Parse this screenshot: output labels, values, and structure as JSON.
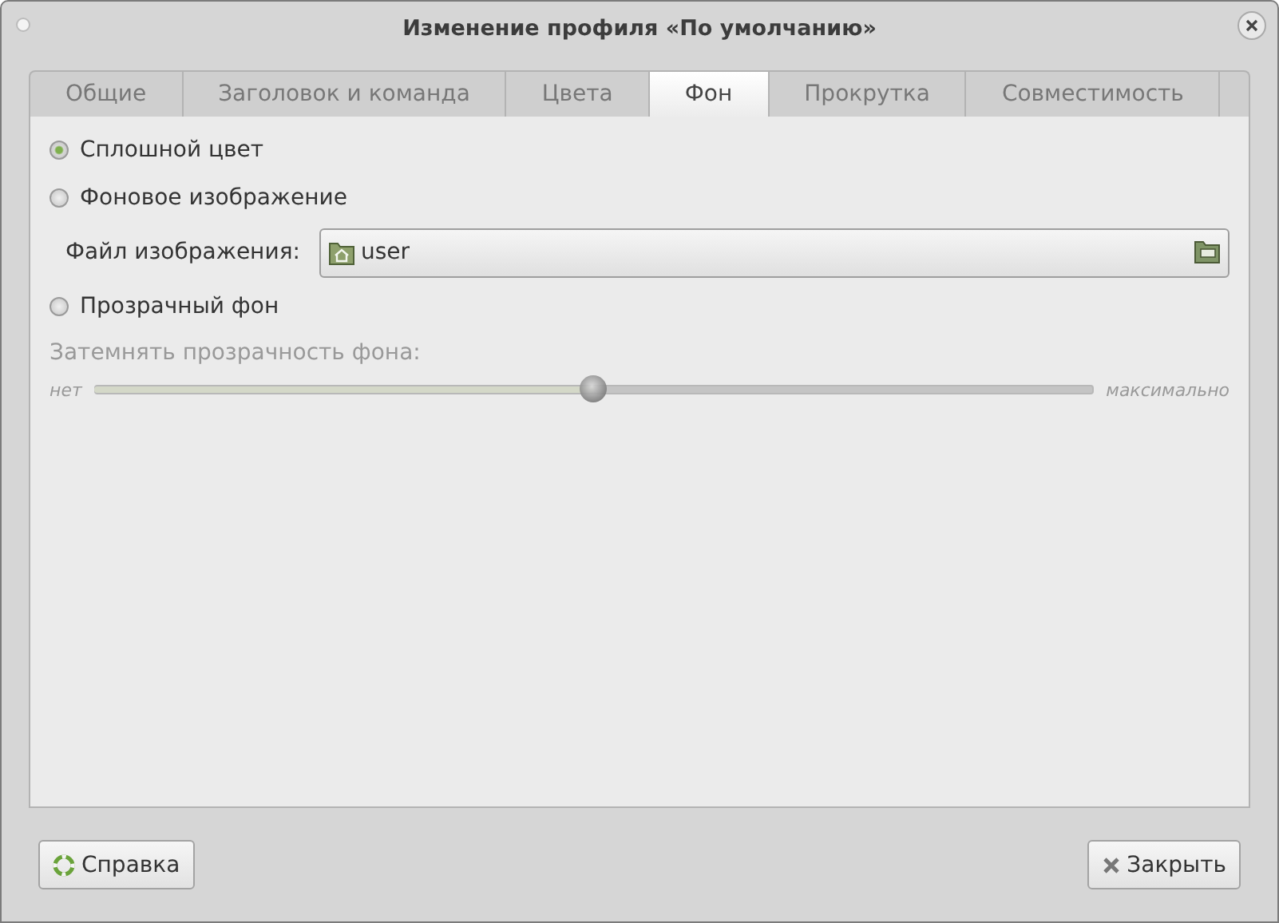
{
  "window": {
    "title": "Изменение профиля «По умолчанию»"
  },
  "tabs": [
    {
      "label": "Общие",
      "selected": false
    },
    {
      "label": "Заголовок и команда",
      "selected": false
    },
    {
      "label": "Цвета",
      "selected": false
    },
    {
      "label": "Фон",
      "selected": true
    },
    {
      "label": "Прокрутка",
      "selected": false
    },
    {
      "label": "Совместимость",
      "selected": false
    }
  ],
  "background_options": [
    {
      "label": "Сплошной цвет",
      "selected": true
    },
    {
      "label": "Фоновое изображение",
      "selected": false
    },
    {
      "label": "Прозрачный фон",
      "selected": false
    }
  ],
  "image_file": {
    "label": "Файл изображения:",
    "value": "user"
  },
  "shade": {
    "label": "Затемнять прозрачность фона:",
    "disabled": true,
    "min_label": "нет",
    "max_label": "максимально",
    "level": 0.5
  },
  "buttons": [
    {
      "label": "Справка",
      "kind": "help"
    },
    {
      "label": "Закрыть",
      "kind": "close"
    }
  ]
}
